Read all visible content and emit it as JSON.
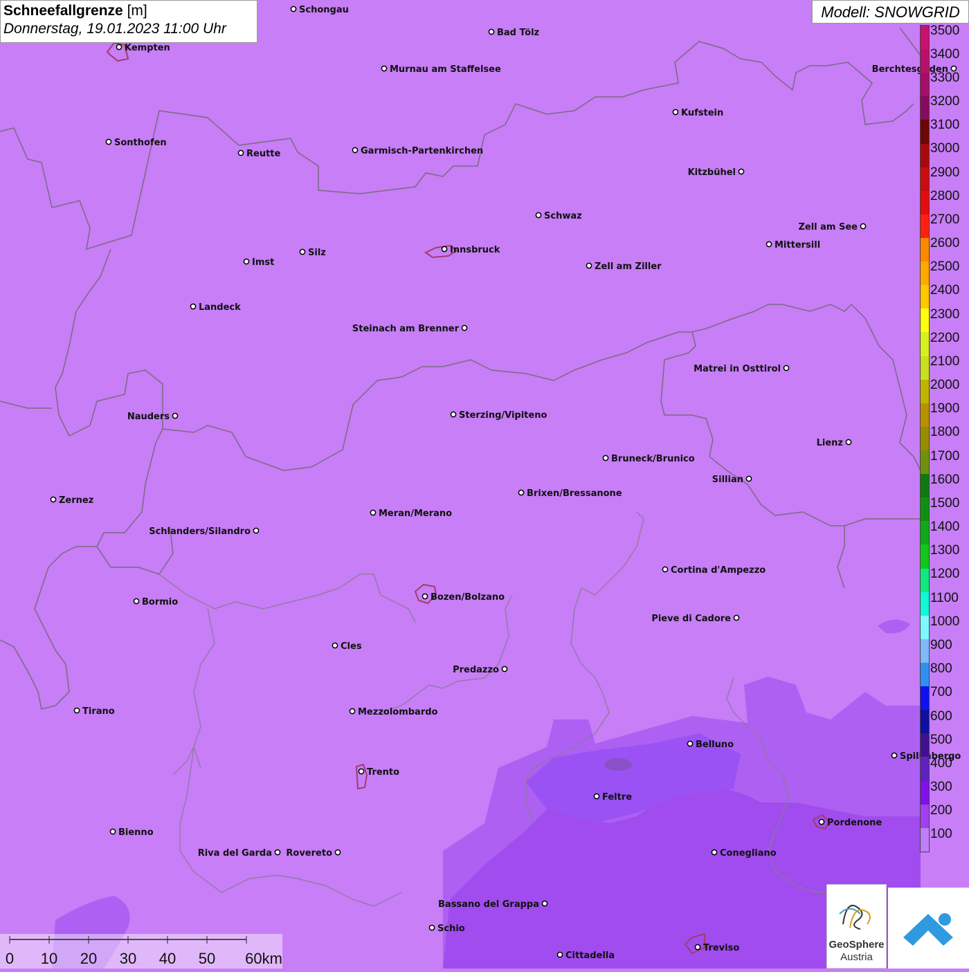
{
  "header": {
    "title": "Schneefallgrenze",
    "unit": "[m]",
    "datetime": "Donnerstag, 19.01.2023 11:00 Uhr"
  },
  "model_label": "Modell: SNOWGRID",
  "colors": {
    "background_field": "#c77ef6",
    "low_field": "#a95cf0",
    "lowest_field": "#9c40e8",
    "border_line": "#7a6a80",
    "urban_outline": "#a03d6e"
  },
  "colorbar": {
    "labels": [
      "3500",
      "3400",
      "3300",
      "3200",
      "3100",
      "3000",
      "2900",
      "2800",
      "2700",
      "2600",
      "2500",
      "2400",
      "2300",
      "2200",
      "2100",
      "2000",
      "1900",
      "1800",
      "1700",
      "1600",
      "1500",
      "1400",
      "1300",
      "1200",
      "1100",
      "1000",
      "900",
      "800",
      "700",
      "600",
      "500",
      "400",
      "300",
      "200",
      "100"
    ],
    "colors": [
      "#c8106e",
      "#b8106a",
      "#a50e68",
      "#880a60",
      "#6e0606",
      "#a80810",
      "#c80c10",
      "#e40c10",
      "#ff2010",
      "#ff8800",
      "#ffa800",
      "#ffc800",
      "#ffff10",
      "#d8f020",
      "#c8e020",
      "#c0b400",
      "#b89000",
      "#988c00",
      "#709010",
      "#107810",
      "#109010",
      "#10a818",
      "#10c818",
      "#10e880",
      "#10f8d8",
      "#80f8ff",
      "#80b8f8",
      "#3090f0",
      "#1010f0",
      "#1010a0",
      "#401090",
      "#6020c0",
      "#8010e8",
      "#a040f0",
      "#c07ef8"
    ]
  },
  "scale_bar": {
    "ticks": [
      "0",
      "10",
      "20",
      "30",
      "40",
      "50",
      "60km"
    ]
  },
  "cities": [
    {
      "name": "Schongau"
    },
    {
      "name": "Bad Tölz"
    },
    {
      "name": "Kempten"
    },
    {
      "name": "Murnau am Staffelsee"
    },
    {
      "name": "Berchtesgaden"
    },
    {
      "name": "Kufstein"
    },
    {
      "name": "Sonthofen"
    },
    {
      "name": "Reutte"
    },
    {
      "name": "Garmisch-Partenkirchen"
    },
    {
      "name": "Kitzbühel"
    },
    {
      "name": "Schwaz"
    },
    {
      "name": "Zell am See"
    },
    {
      "name": "Innsbruck"
    },
    {
      "name": "Mittersill"
    },
    {
      "name": "Imst"
    },
    {
      "name": "Silz"
    },
    {
      "name": "Zell am Ziller"
    },
    {
      "name": "Landeck"
    },
    {
      "name": "Steinach am Brenner"
    },
    {
      "name": "Matrei in Osttirol"
    },
    {
      "name": "Nauders"
    },
    {
      "name": "Sterzing/Vipiteno"
    },
    {
      "name": "Lienz"
    },
    {
      "name": "Bruneck/Brunico"
    },
    {
      "name": "Sillian"
    },
    {
      "name": "Brixen/Bressanone"
    },
    {
      "name": "Zernez"
    },
    {
      "name": "Meran/Merano"
    },
    {
      "name": "Schlanders/Silandro"
    },
    {
      "name": "Cortina d'Ampezzo"
    },
    {
      "name": "Bozen/Bolzano"
    },
    {
      "name": "Pieve di Cadore"
    },
    {
      "name": "Bormio"
    },
    {
      "name": "Cles"
    },
    {
      "name": "Predazzo"
    },
    {
      "name": "Tirano"
    },
    {
      "name": "Mezzolombardo"
    },
    {
      "name": "Belluno"
    },
    {
      "name": "Spilimbergo"
    },
    {
      "name": "Trento"
    },
    {
      "name": "Feltre"
    },
    {
      "name": "Pordenone"
    },
    {
      "name": "Bienno"
    },
    {
      "name": "Riva del Garda"
    },
    {
      "name": "Rovereto"
    },
    {
      "name": "Conegliano"
    },
    {
      "name": "Bassano del Grappa"
    },
    {
      "name": "Schio"
    },
    {
      "name": "Treviso"
    },
    {
      "name": "Cittadella"
    }
  ],
  "logos": {
    "geosphere_line1": "GeoSphere",
    "geosphere_line2": "Austria"
  }
}
